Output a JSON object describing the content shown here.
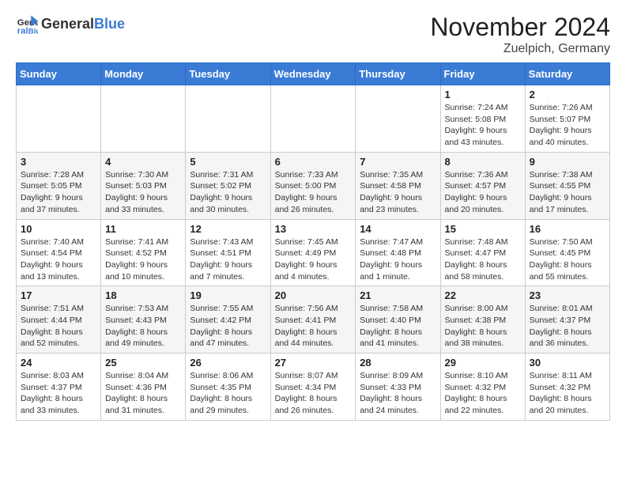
{
  "header": {
    "logo_general": "General",
    "logo_blue": "Blue",
    "month_title": "November 2024",
    "location": "Zuelpich, Germany"
  },
  "days_of_week": [
    "Sunday",
    "Monday",
    "Tuesday",
    "Wednesday",
    "Thursday",
    "Friday",
    "Saturday"
  ],
  "weeks": [
    [
      {
        "day": "",
        "info": ""
      },
      {
        "day": "",
        "info": ""
      },
      {
        "day": "",
        "info": ""
      },
      {
        "day": "",
        "info": ""
      },
      {
        "day": "",
        "info": ""
      },
      {
        "day": "1",
        "info": "Sunrise: 7:24 AM\nSunset: 5:08 PM\nDaylight: 9 hours\nand 43 minutes."
      },
      {
        "day": "2",
        "info": "Sunrise: 7:26 AM\nSunset: 5:07 PM\nDaylight: 9 hours\nand 40 minutes."
      }
    ],
    [
      {
        "day": "3",
        "info": "Sunrise: 7:28 AM\nSunset: 5:05 PM\nDaylight: 9 hours\nand 37 minutes."
      },
      {
        "day": "4",
        "info": "Sunrise: 7:30 AM\nSunset: 5:03 PM\nDaylight: 9 hours\nand 33 minutes."
      },
      {
        "day": "5",
        "info": "Sunrise: 7:31 AM\nSunset: 5:02 PM\nDaylight: 9 hours\nand 30 minutes."
      },
      {
        "day": "6",
        "info": "Sunrise: 7:33 AM\nSunset: 5:00 PM\nDaylight: 9 hours\nand 26 minutes."
      },
      {
        "day": "7",
        "info": "Sunrise: 7:35 AM\nSunset: 4:58 PM\nDaylight: 9 hours\nand 23 minutes."
      },
      {
        "day": "8",
        "info": "Sunrise: 7:36 AM\nSunset: 4:57 PM\nDaylight: 9 hours\nand 20 minutes."
      },
      {
        "day": "9",
        "info": "Sunrise: 7:38 AM\nSunset: 4:55 PM\nDaylight: 9 hours\nand 17 minutes."
      }
    ],
    [
      {
        "day": "10",
        "info": "Sunrise: 7:40 AM\nSunset: 4:54 PM\nDaylight: 9 hours\nand 13 minutes."
      },
      {
        "day": "11",
        "info": "Sunrise: 7:41 AM\nSunset: 4:52 PM\nDaylight: 9 hours\nand 10 minutes."
      },
      {
        "day": "12",
        "info": "Sunrise: 7:43 AM\nSunset: 4:51 PM\nDaylight: 9 hours\nand 7 minutes."
      },
      {
        "day": "13",
        "info": "Sunrise: 7:45 AM\nSunset: 4:49 PM\nDaylight: 9 hours\nand 4 minutes."
      },
      {
        "day": "14",
        "info": "Sunrise: 7:47 AM\nSunset: 4:48 PM\nDaylight: 9 hours\nand 1 minute."
      },
      {
        "day": "15",
        "info": "Sunrise: 7:48 AM\nSunset: 4:47 PM\nDaylight: 8 hours\nand 58 minutes."
      },
      {
        "day": "16",
        "info": "Sunrise: 7:50 AM\nSunset: 4:45 PM\nDaylight: 8 hours\nand 55 minutes."
      }
    ],
    [
      {
        "day": "17",
        "info": "Sunrise: 7:51 AM\nSunset: 4:44 PM\nDaylight: 8 hours\nand 52 minutes."
      },
      {
        "day": "18",
        "info": "Sunrise: 7:53 AM\nSunset: 4:43 PM\nDaylight: 8 hours\nand 49 minutes."
      },
      {
        "day": "19",
        "info": "Sunrise: 7:55 AM\nSunset: 4:42 PM\nDaylight: 8 hours\nand 47 minutes."
      },
      {
        "day": "20",
        "info": "Sunrise: 7:56 AM\nSunset: 4:41 PM\nDaylight: 8 hours\nand 44 minutes."
      },
      {
        "day": "21",
        "info": "Sunrise: 7:58 AM\nSunset: 4:40 PM\nDaylight: 8 hours\nand 41 minutes."
      },
      {
        "day": "22",
        "info": "Sunrise: 8:00 AM\nSunset: 4:38 PM\nDaylight: 8 hours\nand 38 minutes."
      },
      {
        "day": "23",
        "info": "Sunrise: 8:01 AM\nSunset: 4:37 PM\nDaylight: 8 hours\nand 36 minutes."
      }
    ],
    [
      {
        "day": "24",
        "info": "Sunrise: 8:03 AM\nSunset: 4:37 PM\nDaylight: 8 hours\nand 33 minutes."
      },
      {
        "day": "25",
        "info": "Sunrise: 8:04 AM\nSunset: 4:36 PM\nDaylight: 8 hours\nand 31 minutes."
      },
      {
        "day": "26",
        "info": "Sunrise: 8:06 AM\nSunset: 4:35 PM\nDaylight: 8 hours\nand 29 minutes."
      },
      {
        "day": "27",
        "info": "Sunrise: 8:07 AM\nSunset: 4:34 PM\nDaylight: 8 hours\nand 26 minutes."
      },
      {
        "day": "28",
        "info": "Sunrise: 8:09 AM\nSunset: 4:33 PM\nDaylight: 8 hours\nand 24 minutes."
      },
      {
        "day": "29",
        "info": "Sunrise: 8:10 AM\nSunset: 4:32 PM\nDaylight: 8 hours\nand 22 minutes."
      },
      {
        "day": "30",
        "info": "Sunrise: 8:11 AM\nSunset: 4:32 PM\nDaylight: 8 hours\nand 20 minutes."
      }
    ]
  ]
}
